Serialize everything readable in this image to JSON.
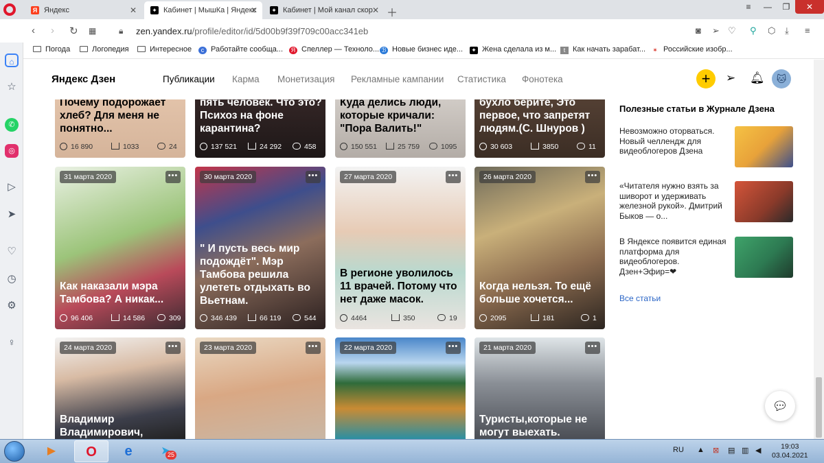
{
  "browser": {
    "tabs": [
      {
        "label": "Яндекс",
        "favicon": "yandex-icon"
      },
      {
        "label": "Кабинет | МышКа | Яндекс",
        "favicon": "zen-icon"
      },
      {
        "label": "Кабинет | Мой канал скор",
        "favicon": "zen-icon"
      }
    ],
    "url_domain": "zen.yandex.ru",
    "url_path": "/profile/editor/id/5d00b9f39f709c00acc341eb",
    "bookmarks": [
      "Погода",
      "Логопедия",
      "Интересное",
      "Работайте сообща...",
      "Спеллер — Техноло...",
      "Новые бизнес иде...",
      "Жена сделала из м...",
      "Как начать зарабат...",
      "Российские изобр..."
    ]
  },
  "zen": {
    "logo": "Яндекс Дзен",
    "nav": [
      "Публикации",
      "Карма",
      "Монетизация",
      "Рекламные кампании",
      "Статистика",
      "Фонотека"
    ]
  },
  "cards_row1": [
    {
      "title": "Почему подорожает хлеб? Для меня не понятно...",
      "views": "16 890",
      "reads": "1033",
      "comments": "24"
    },
    {
      "title": "пять человек. Что это? Психоз на фоне карантина?",
      "views": "137 521",
      "reads": "24 292",
      "comments": "458"
    },
    {
      "title": "Куда делись люди, которые кричали: \"Пора Валить!\"",
      "views": "150 551",
      "reads": "25 759",
      "comments": "1095"
    },
    {
      "title": "бухло берите, Это первое, что запретят людям.(С. Шнуров )",
      "views": "30 603",
      "reads": "3850",
      "comments": "11"
    }
  ],
  "cards_row2": [
    {
      "date": "31 марта 2020",
      "title": "Как наказали мэра Тамбова? А никак...",
      "views": "96 406",
      "reads": "14 586",
      "comments": "309"
    },
    {
      "date": "30 марта 2020",
      "title": "\" И пусть весь мир подождёт\". Мэр Тамбова решила улететь отдыхать во Вьетнам.",
      "views": "346 439",
      "reads": "66 119",
      "comments": "544"
    },
    {
      "date": "27 марта 2020",
      "title": "В регионе уволилось 11 врачей. Потому что нет даже масок.",
      "views": "4464",
      "reads": "350",
      "comments": "19"
    },
    {
      "date": "26 марта 2020",
      "title": "Когда нельзя. То ещё больше хочется...",
      "views": "2095",
      "reads": "181",
      "comments": "1"
    }
  ],
  "cards_row3": [
    {
      "date": "24 марта 2020",
      "title": "Владимир Владимирович,"
    },
    {
      "date": "23 марта 2020",
      "title": ""
    },
    {
      "date": "22 марта 2020",
      "title": ""
    },
    {
      "date": "21 марта 2020",
      "title": "Туристы,которые не могут выехать."
    }
  ],
  "journal": {
    "heading": "Полезные статьи в Журнале Дзена",
    "items": [
      "Невозможно оторваться. Новый челлендж для видеоблогеров Дзена",
      "«Читателя нужно взять за шиворот и удерживать железной рукой». Дмитрий Быков — о...",
      "В Яндексе появится единая платформа для видеоблогеров. Дзен+Эфир=❤"
    ],
    "all_link": "Все статьи"
  },
  "taskbar": {
    "lang": "RU",
    "time": "19:03",
    "date": "03.04.2021",
    "telegram_badge": "25"
  },
  "colors": {
    "accent": "#ffcc00",
    "link": "#2a65c6",
    "opera": "#e0162b"
  }
}
